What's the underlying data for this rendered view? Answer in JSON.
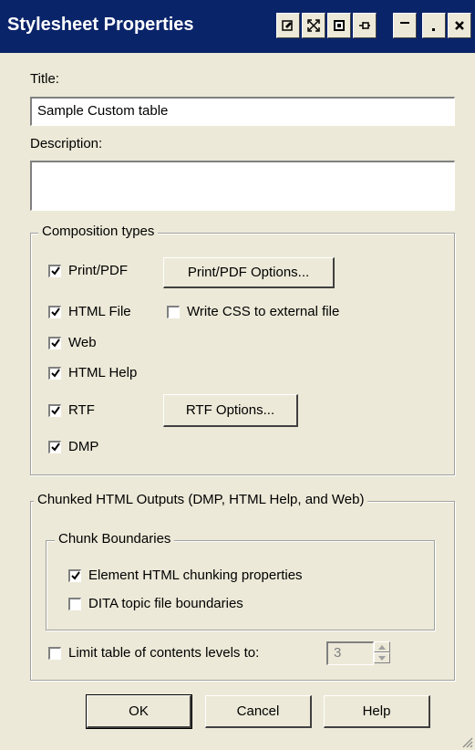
{
  "window": {
    "title": "Stylesheet Properties",
    "buttons": [
      "pin-icon",
      "restore-icon",
      "dock-icon",
      "pushpin-icon",
      "minimize-icon",
      "dot-icon",
      "close-icon"
    ]
  },
  "title_field": {
    "label": "Title:",
    "value": "Sample Custom table"
  },
  "description_field": {
    "label": "Description:",
    "value": ""
  },
  "composition": {
    "legend": "Composition types",
    "items": [
      {
        "label": "Print/PDF",
        "checked": true
      },
      {
        "label": "HTML File",
        "checked": true
      },
      {
        "label": "Web",
        "checked": true
      },
      {
        "label": "HTML Help",
        "checked": true
      },
      {
        "label": "RTF",
        "checked": true
      },
      {
        "label": "DMP",
        "checked": true
      }
    ],
    "print_pdf_options_label": "Print/PDF Options...",
    "write_css_label": "Write CSS to external file",
    "write_css_checked": false,
    "rtf_options_label": "RTF Options..."
  },
  "chunked": {
    "legend": "Chunked HTML Outputs (DMP, HTML Help, and Web)",
    "boundaries_legend": "Chunk Boundaries",
    "element_html_label": "Element HTML chunking properties",
    "element_html_checked": true,
    "dita_label": "DITA topic file boundaries",
    "dita_checked": false,
    "limit_label": "Limit table of contents levels to:",
    "limit_checked": false,
    "limit_value": "3"
  },
  "footer": {
    "ok_label": "OK",
    "cancel_label": "Cancel",
    "help_label": "Help"
  }
}
